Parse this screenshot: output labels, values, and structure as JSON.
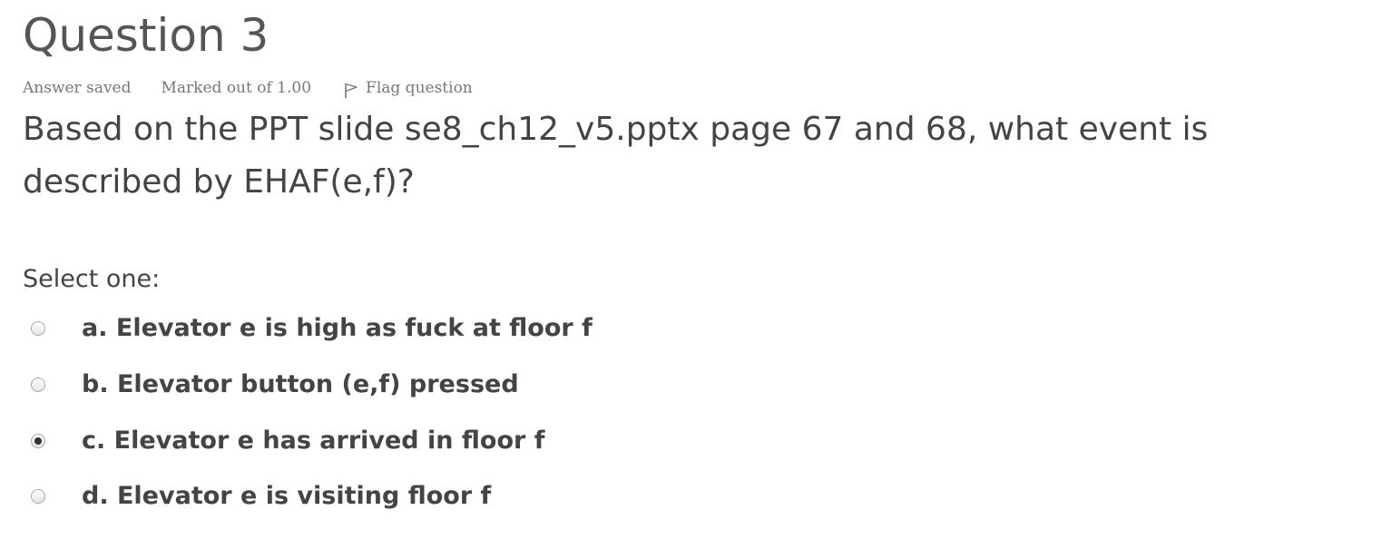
{
  "question": {
    "title": "Question 3",
    "state": "Answer saved",
    "grade": "Marked out of 1.00",
    "flag_label": "Flag question",
    "flag_icon": "flag-icon",
    "text": "Based on the PPT slide se8_ch12_v5.pptx page 67 and 68, what event is described by EHAF(e,f)?",
    "prompt": "Select one:",
    "options": [
      {
        "label": "a. Elevator e is high as fuck at floor f",
        "checked": false
      },
      {
        "label": "b. Elevator button (e,f) pressed",
        "checked": false
      },
      {
        "label": "c. Elevator e has arrived in floor f",
        "checked": true
      },
      {
        "label": "d. Elevator e is visiting floor f",
        "checked": false
      }
    ]
  },
  "colors": {
    "text": "#444444",
    "meta": "#777777",
    "radio_border": "#a8a8a8",
    "radio_dot": "#333333"
  }
}
